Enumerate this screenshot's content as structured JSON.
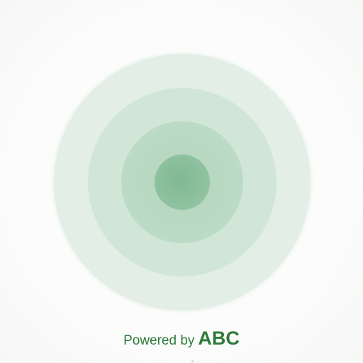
{
  "splash": {
    "footer": {
      "prefix": "Powered by",
      "brand": "ABC"
    },
    "colors": {
      "accent": "#2e7a3a",
      "ring_outer": "#e3efe6",
      "ring_second": "#d1e6d7",
      "ring_third": "#bcdbc5",
      "ring_core": "#8ec19f"
    },
    "icon": "concentric-circles-loading-icon"
  }
}
